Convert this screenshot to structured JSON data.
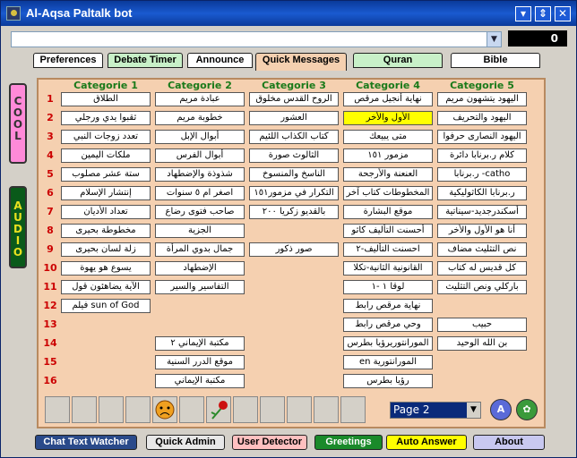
{
  "window": {
    "title": "Al-Aqsa Paltalk bot",
    "minimize": "▾",
    "maximize": "⇕",
    "close": "✕"
  },
  "toolbar": {
    "combo_value": "",
    "counter": "0"
  },
  "tabs": [
    {
      "label": "Preferences",
      "bg": "#ffffff"
    },
    {
      "label": "Debate Timer",
      "bg": "#c8f0c8"
    },
    {
      "label": "Announce",
      "bg": "#ffffff"
    },
    {
      "label": "Quick Messages",
      "bg": "#f5d0b0"
    },
    {
      "label": "Quran",
      "bg": "#c8f0c8"
    },
    {
      "label": "Bible",
      "bg": "#ffffff"
    }
  ],
  "side": {
    "cool": [
      "C",
      "O",
      "O",
      "L"
    ],
    "audio": [
      "A",
      "U",
      "D",
      "I",
      "O"
    ]
  },
  "categories": [
    "Categorie 1",
    "Categorie 2",
    "Categorie 3",
    "Categorie 4",
    "Categorie 5"
  ],
  "row_numbers": [
    "1",
    "2",
    "3",
    "4",
    "5",
    "6",
    "7",
    "8",
    "9",
    "10",
    "11",
    "12",
    "13",
    "14",
    "15",
    "16"
  ],
  "grid": [
    [
      "الطلاق",
      "ثقبوا يدي ورجلي",
      "تعدد زوجات النبي",
      "ملكات اليمين",
      "ستة عشر مصلوب",
      "إنتشار الإسلام",
      "تعداد الأديان",
      "مخطوطة بحيرى",
      "زلة لسان بحيرى",
      "يسوع هو يهوة",
      "الآية يضاهئون قول",
      "فيلم sun of God",
      "",
      "",
      "",
      ""
    ],
    [
      "عبادة مريم",
      "خطوبة مريم",
      "أبوال الإبل",
      "أبوال الفرس",
      "شذوذة والإضطهاد",
      "اصغر ام ٥ سنوات",
      "صاحب فتوى رضاع",
      "الجزية",
      "جمال بدوي المرأة",
      "الإضطهاد",
      "التفاسير والسير",
      "",
      "",
      "مكتبة الإيماني ٢",
      "موقع الدرر السنية",
      "مكتبة الإيماني"
    ],
    [
      "الروح القدس مخلوق",
      "العشور",
      "كتاب الكذاب اللئيم",
      "الثالوث صورة",
      "الناسخ والمنسوخ",
      "التكرار في مزمور١٥١",
      "بالقديو زكريا ٢٠٠",
      "",
      "صور ذكور",
      "",
      "",
      "",
      "",
      "",
      "",
      ""
    ],
    [
      "نهاية أنجيل مرقص",
      "الأول والأخر",
      "متى يبيعك",
      "مزمور ١٥١",
      "العنعنة والأرجحة",
      "المخطوطات كتاب آخر",
      "موقع البشارة",
      "أحسنت التأليف كاثو",
      "احسنت التأليف-٢",
      "القانونية الثانية-تكلا",
      "لوقا ١ -١",
      "نهاية مرقص رابط",
      "وحي مرقص رابط",
      "المورانتوريرؤيا بطرس",
      "en المورانتورية",
      "رؤيا بطرس"
    ],
    [
      "اليهود يتشهون مريم",
      "اليهود والتحريف",
      "اليهود النصارى حرفوا",
      "كلام ر.برنابا دائرة",
      "ر.برنابا -catho",
      "ر.برنابا الكاثوليكية",
      "أسكندرجديد-سيناتية",
      "أنا هو الأول والأخر",
      "نص التثليث مضاف",
      "كل قديس له كتاب",
      "باركلي ونص التثليث",
      "",
      "حبيب",
      "بن الله الوحيد",
      "",
      ""
    ]
  ],
  "highlight": {
    "col": 3,
    "row": 1
  },
  "bottom": {
    "page": "Page 2",
    "slot_icons": [
      "sad-face",
      "rose"
    ]
  },
  "buttons": [
    {
      "label": "Chat Text Watcher",
      "bg": "#2a4a8a",
      "fg": "#ffffff"
    },
    {
      "label": "Quick Admin",
      "bg": "#e8e8e8",
      "fg": "#000000"
    },
    {
      "label": "User Detector",
      "bg": "#ffc0c0",
      "fg": "#000000"
    },
    {
      "label": "Greetings",
      "bg": "#1a8a2a",
      "fg": "#ffffff"
    },
    {
      "label": "Auto Answer",
      "bg": "#ffff00",
      "fg": "#000000"
    },
    {
      "label": "About",
      "bg": "#c8c8f0",
      "fg": "#000000"
    }
  ]
}
